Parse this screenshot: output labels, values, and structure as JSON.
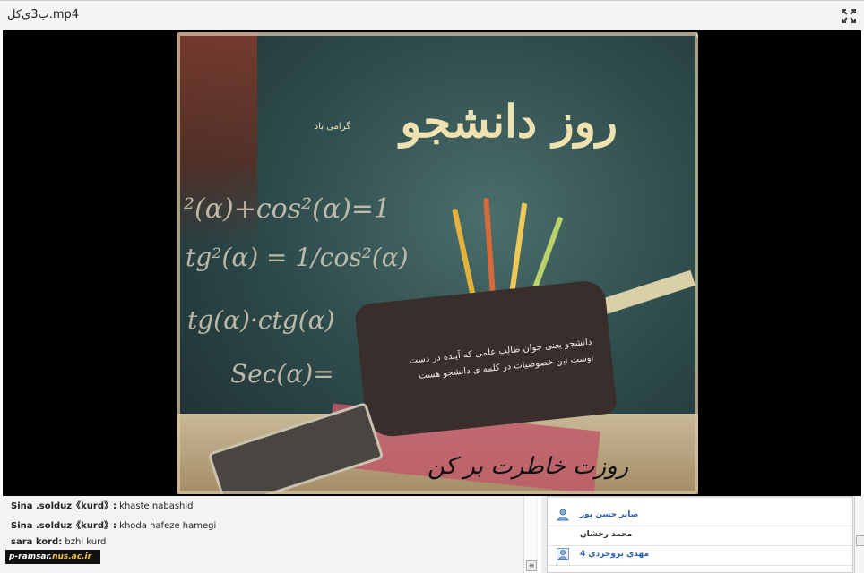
{
  "window": {
    "title": "ب3ی‌کل.mp4",
    "fullscreen_icon": "expand-arrows-icon"
  },
  "video": {
    "banner_title": "روز دانشجو",
    "banner_subtitle": "گرامی باد",
    "formulas": [
      "²(α)+cos²(α)=1",
      "tg²(α) = 1/cos²(α)",
      "tg(α)·ctg(α)",
      "Sec(α)="
    ],
    "pouch_text": [
      "دانشجو یعنی جوان طالب علمی که آینده در دست",
      "اوست این خصوصیات در کلمه ی دانشجو هست"
    ],
    "signature": "روزت خاطرت بر کن"
  },
  "chat": {
    "messages": [
      {
        "author": "Sina .solduz《kurd》:",
        "text": "khaste nabashid"
      },
      {
        "author": "Sina .solduz《kurd》:",
        "text": "khoda hafeze hamegi"
      },
      {
        "author": "sara kord:",
        "text": "bzhi kurd"
      }
    ],
    "logo": {
      "prefix": "p-ramsar.",
      "suffix": "nus.ac.ir"
    },
    "scroll_icon": "scroll-grip-icon"
  },
  "attendees": {
    "rows": [
      {
        "name": "صابر حسن پور",
        "icon": "user-icon",
        "style": "link"
      },
      {
        "name": "محمد رخشان",
        "icon": "none",
        "style": "plain"
      },
      {
        "name": "مهدي بروجردي 4",
        "icon": "user-presenter-icon",
        "style": "link"
      }
    ]
  }
}
